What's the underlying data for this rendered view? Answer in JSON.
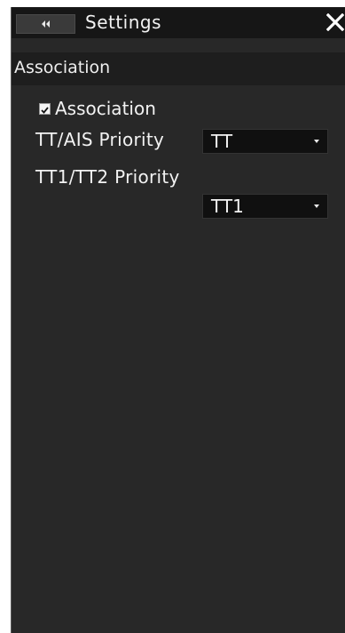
{
  "titlebar": {
    "back_icon": "double-chevron-left-icon",
    "title": "Settings",
    "close_icon": "close-icon"
  },
  "section": {
    "title": "Association"
  },
  "association": {
    "label": "Association",
    "checked": true
  },
  "tt_ais_priority": {
    "label": "TT/AIS Priority",
    "value": "TT"
  },
  "tt1_tt2_priority": {
    "label": "TT1/TT2 Priority",
    "value": "TT1"
  },
  "colors": {
    "panel_bg": "#282828",
    "titlebar_bg": "#161616",
    "dropdown_bg": "#101010",
    "text": "#f2f2f2"
  }
}
